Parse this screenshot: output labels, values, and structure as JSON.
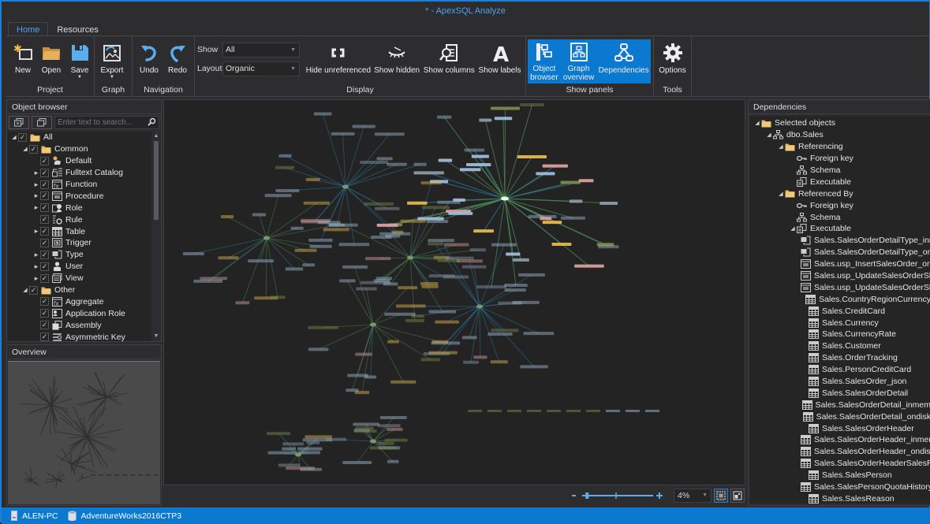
{
  "window": {
    "title": "* - ApexSQL Analyze"
  },
  "tabs": [
    {
      "label": "Home",
      "active": true
    },
    {
      "label": "Resources",
      "active": false
    }
  ],
  "ribbon": {
    "groups": {
      "project": {
        "label": "Project",
        "buttons": {
          "new": "New",
          "open": "Open",
          "save": "Save"
        }
      },
      "graph": {
        "label": "Graph",
        "buttons": {
          "export": "Export"
        }
      },
      "navigation": {
        "label": "Navigation",
        "buttons": {
          "undo": "Undo",
          "redo": "Redo"
        }
      },
      "display": {
        "label": "Display",
        "show_label": "Show",
        "show_value": "All",
        "layout_label": "Layout",
        "layout_value": "Organic",
        "buttons": {
          "hide_unreferenced": "Hide unreferenced",
          "show_hidden": "Show hidden",
          "show_columns": "Show columns",
          "show_labels": "Show labels"
        }
      },
      "show_panels": {
        "label": "Show panels",
        "buttons": {
          "object_browser_1": "Object",
          "object_browser_2": "browser",
          "graph_overview_1": "Graph",
          "graph_overview_2": "overview",
          "dependencies": "Dependencies"
        }
      },
      "tools": {
        "label": "Tools",
        "buttons": {
          "options": "Options"
        }
      }
    }
  },
  "object_browser": {
    "title": "Object browser",
    "search_placeholder": "Enter text to search...",
    "items": [
      {
        "label": "All",
        "level": 0,
        "expander": "expanded",
        "icon": "folder-icon"
      },
      {
        "label": "Common",
        "level": 1,
        "expander": "expanded",
        "icon": "folder-icon"
      },
      {
        "label": "Default",
        "level": 2,
        "expander": "none",
        "icon": "default-icon"
      },
      {
        "label": "Fulltext Catalog",
        "level": 2,
        "expander": "collapsed",
        "icon": "fulltext-catalog-icon"
      },
      {
        "label": "Function",
        "level": 2,
        "expander": "collapsed",
        "icon": "function-icon"
      },
      {
        "label": "Procedure",
        "level": 2,
        "expander": "collapsed",
        "icon": "procedure-icon"
      },
      {
        "label": "Role",
        "level": 2,
        "expander": "collapsed",
        "icon": "role-icon"
      },
      {
        "label": "Rule",
        "level": 2,
        "expander": "none",
        "icon": "rule-icon"
      },
      {
        "label": "Table",
        "level": 2,
        "expander": "collapsed",
        "icon": "table-icon"
      },
      {
        "label": "Trigger",
        "level": 2,
        "expander": "none",
        "icon": "trigger-icon"
      },
      {
        "label": "Type",
        "level": 2,
        "expander": "collapsed",
        "icon": "type-icon"
      },
      {
        "label": "User",
        "level": 2,
        "expander": "collapsed",
        "icon": "user-icon"
      },
      {
        "label": "View",
        "level": 2,
        "expander": "collapsed",
        "icon": "view-icon"
      },
      {
        "label": "Other",
        "level": 1,
        "expander": "expanded",
        "icon": "folder-icon"
      },
      {
        "label": "Aggregate",
        "level": 2,
        "expander": "none",
        "icon": "aggregate-icon"
      },
      {
        "label": "Application Role",
        "level": 2,
        "expander": "none",
        "icon": "application-role-icon"
      },
      {
        "label": "Assembly",
        "level": 2,
        "expander": "none",
        "icon": "assembly-icon"
      },
      {
        "label": "Asymmetric Key",
        "level": 2,
        "expander": "none",
        "icon": "asymmetric-key-icon"
      }
    ]
  },
  "overview": {
    "title": "Overview"
  },
  "canvas": {
    "zoom_value": "4%",
    "zoom_slider_fraction": 0.05
  },
  "dependencies": {
    "title": "Dependencies",
    "items": [
      {
        "label": "Selected objects",
        "level": 0,
        "expander": "expanded",
        "icon": "folder-icon"
      },
      {
        "label": "dbo.Sales",
        "level": 1,
        "expander": "expanded",
        "icon": "schema-icon"
      },
      {
        "label": "Referencing",
        "level": 2,
        "expander": "expanded",
        "icon": "folder-icon"
      },
      {
        "label": "Foreign key",
        "level": 3,
        "expander": "none",
        "icon": "key-icon"
      },
      {
        "label": "Schema",
        "level": 3,
        "expander": "none",
        "icon": "schema-icon"
      },
      {
        "label": "Executable",
        "level": 3,
        "expander": "none",
        "icon": "executable-icon"
      },
      {
        "label": "Referenced By",
        "level": 2,
        "expander": "expanded",
        "icon": "folder-icon"
      },
      {
        "label": "Foreign key",
        "level": 3,
        "expander": "none",
        "icon": "key-icon"
      },
      {
        "label": "Schema",
        "level": 3,
        "expander": "none",
        "icon": "schema-icon"
      },
      {
        "label": "Executable",
        "level": 3,
        "expander": "expanded",
        "icon": "executable-icon"
      },
      {
        "label": "Sales.SalesOrderDetailType_inmem",
        "level": 4,
        "expander": "none",
        "icon": "type-icon"
      },
      {
        "label": "Sales.SalesOrderDetailType_ondisk",
        "level": 4,
        "expander": "none",
        "icon": "type-icon"
      },
      {
        "label": "Sales.usp_InsertSalesOrder_ondisk",
        "level": 4,
        "expander": "none",
        "icon": "procedure-icon"
      },
      {
        "label": "Sales.usp_UpdateSalesOrderShip",
        "level": 4,
        "expander": "none",
        "icon": "procedure-icon"
      },
      {
        "label": "Sales.usp_UpdateSalesOrderShip",
        "level": 4,
        "expander": "none",
        "icon": "procedure-icon"
      },
      {
        "label": "Sales.CountryRegionCurrency",
        "level": 4,
        "expander": "none",
        "icon": "table-icon"
      },
      {
        "label": "Sales.CreditCard",
        "level": 4,
        "expander": "none",
        "icon": "table-icon"
      },
      {
        "label": "Sales.Currency",
        "level": 4,
        "expander": "none",
        "icon": "table-icon"
      },
      {
        "label": "Sales.CurrencyRate",
        "level": 4,
        "expander": "none",
        "icon": "table-icon"
      },
      {
        "label": "Sales.Customer",
        "level": 4,
        "expander": "none",
        "icon": "table-icon"
      },
      {
        "label": "Sales.OrderTracking",
        "level": 4,
        "expander": "none",
        "icon": "table-icon"
      },
      {
        "label": "Sales.PersonCreditCard",
        "level": 4,
        "expander": "none",
        "icon": "table-icon"
      },
      {
        "label": "Sales.SalesOrder_json",
        "level": 4,
        "expander": "none",
        "icon": "table-icon"
      },
      {
        "label": "Sales.SalesOrderDetail",
        "level": 4,
        "expander": "none",
        "icon": "table-icon"
      },
      {
        "label": "Sales.SalesOrderDetail_inmem",
        "level": 4,
        "expander": "none",
        "icon": "table-icon"
      },
      {
        "label": "Sales.SalesOrderDetail_ondisk",
        "level": 4,
        "expander": "none",
        "icon": "table-icon"
      },
      {
        "label": "Sales.SalesOrderHeader",
        "level": 4,
        "expander": "none",
        "icon": "table-icon"
      },
      {
        "label": "Sales.SalesOrderHeader_inmem",
        "level": 4,
        "expander": "none",
        "icon": "table-icon"
      },
      {
        "label": "Sales.SalesOrderHeader_ondisk",
        "level": 4,
        "expander": "none",
        "icon": "table-icon"
      },
      {
        "label": "Sales.SalesOrderHeaderSalesReason",
        "level": 4,
        "expander": "none",
        "icon": "table-icon"
      },
      {
        "label": "Sales.SalesPerson",
        "level": 4,
        "expander": "none",
        "icon": "table-icon"
      },
      {
        "label": "Sales.SalesPersonQuotaHistory",
        "level": 4,
        "expander": "none",
        "icon": "table-icon"
      },
      {
        "label": "Sales.SalesReason",
        "level": 4,
        "expander": "none",
        "icon": "table-icon"
      }
    ]
  },
  "statusbar": {
    "server": "ALEN-PC",
    "database": "AdventureWorks2016CTP3"
  },
  "colors": {
    "accent": "#0b79d0",
    "title": "#4aa3f0",
    "edge_green": "#4f8a55",
    "edge_blue": "#2d7fa8",
    "edge_pink": "#b88a84",
    "node_blue": "#9fbcd8",
    "node_yellow": "#e6b84e",
    "node_pink": "#d9a0a0",
    "node_olive": "#7a8a4a"
  }
}
